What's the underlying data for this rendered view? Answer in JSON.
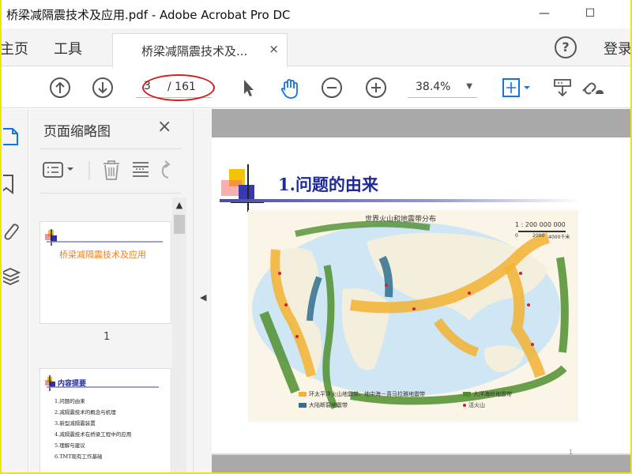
{
  "window": {
    "title": "桥梁减隔震技术及应用.pdf - Adobe Acrobat Pro DC",
    "minimize": "—",
    "maximize": "☐"
  },
  "menubar": {
    "home": "主页",
    "tools": "工具",
    "tab_label": "桥梁减隔震技术及...",
    "tab_close": "×",
    "help": "?",
    "login": "登录"
  },
  "toolbar": {
    "current_page": "3",
    "total_pages": "/ 161",
    "zoom": "38.4%"
  },
  "thumbnails": {
    "title": "页面缩略图",
    "close": "×",
    "page1": {
      "title": "桥梁减隔震技术及应用",
      "number": "1"
    },
    "page2": {
      "title": "内容提要",
      "items": [
        "1.问题的由来",
        "2.减隔震技术的概念与机理",
        "3.新型减隔震装置",
        "4.减隔震技术在桥梁工程中的应用",
        "5.理解与建议",
        "6.TMT现有工作基础"
      ]
    }
  },
  "document": {
    "heading_num": "1.",
    "heading_text": "问题的由来",
    "map_title": "世界火山和地震带分布",
    "scale": "1 : 200 000 000",
    "scale_units": [
      "0",
      "2000",
      "4000千米"
    ],
    "legend": [
      {
        "label": "环太平洋火山地震带、地中海－喜马拉雅地震带",
        "color": "#f2b233"
      },
      {
        "label": "大洋海岭地震带",
        "color": "#4f8f2f"
      },
      {
        "label": "大陆断裂地震带",
        "color": "#2f6f8f"
      },
      {
        "label": "活火山",
        "color": "#d0213c"
      }
    ],
    "page_number": "1"
  },
  "colors": {
    "accent_red": "#d21f1f",
    "heading_blue": "#1f2a99",
    "acrobat_blue": "#1473e6"
  }
}
